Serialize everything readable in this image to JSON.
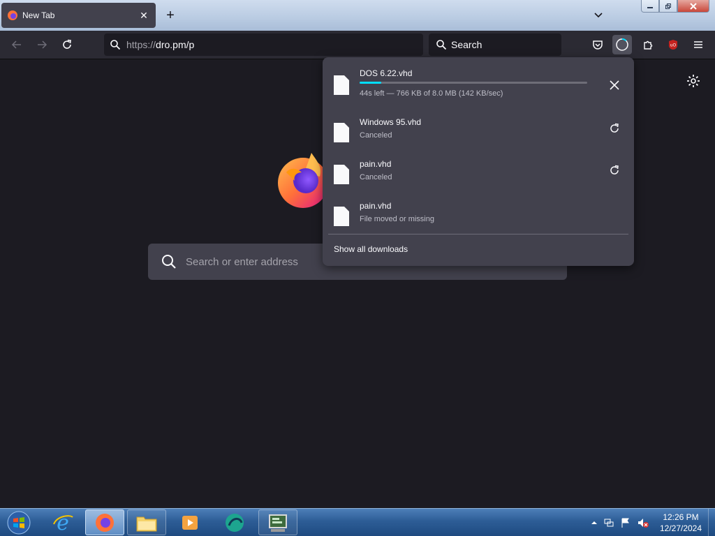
{
  "tab": {
    "title": "New Tab",
    "favicon": "firefox-icon"
  },
  "toolbar": {
    "url_scheme": "https://",
    "url_rest": "dro.pm/p",
    "search_placeholder": "Search"
  },
  "newtab": {
    "search_placeholder": "Search or enter address"
  },
  "downloads": {
    "items": [
      {
        "name": "DOS 6.22.vhd",
        "status": "44s left — 766 KB of 8.0 MB (142 KB/sec)",
        "progress": 0.094,
        "action": "cancel"
      },
      {
        "name": "Windows 95.vhd",
        "status": "Canceled",
        "action": "retry"
      },
      {
        "name": "pain.vhd",
        "status": "Canceled",
        "action": "retry"
      },
      {
        "name": "pain.vhd",
        "status": "File moved or missing",
        "action": ""
      }
    ],
    "show_all": "Show all downloads"
  },
  "taskbar": {
    "apps": [
      "start-orb",
      "internet-explorer",
      "firefox",
      "file-explorer",
      "media-player",
      "browser-app",
      "system-app"
    ],
    "time": "12:26 PM",
    "date": "12/27/2024"
  },
  "colors": {
    "accent": "#00ddff",
    "ublock": "#c5221f"
  }
}
